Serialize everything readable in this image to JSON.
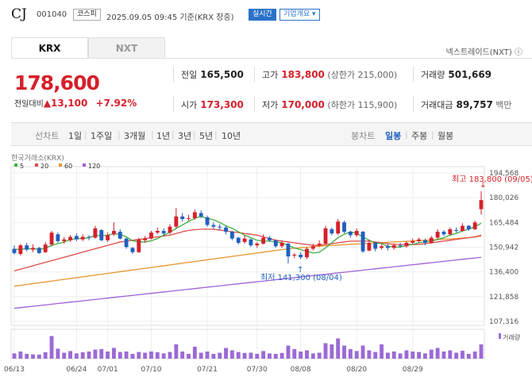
{
  "header": {
    "name": "CJ",
    "code": "001040",
    "market": "코스피",
    "timestamp": "2025.09.05 09:45  기준(KRX 장중)",
    "realtime": "실시간",
    "company_info": "기업개요 ▾"
  },
  "tabs": [
    "KRX",
    "NXT"
  ],
  "nxt_link": "넥스트레이드(NXT) ⓘ",
  "quote": {
    "price": "178,600",
    "change_label": "전일대비",
    "change_arrow": "▲",
    "change": "13,100",
    "change_pct": "+7.92%"
  },
  "stats": {
    "prev_close_label": "전일",
    "prev_close": "165,500",
    "high_label": "고가",
    "high": "183,800",
    "upper_limit": "(상한가 215,000)",
    "volume_label": "거래량",
    "volume": "501,669",
    "open_label": "시가",
    "open": "173,300",
    "low_label": "저가",
    "low": "170,000",
    "lower_limit": "(하한가 115,900)",
    "value_label": "거래대금",
    "value": "89,757",
    "value_unit": "백만"
  },
  "period_bar": {
    "line_label": "선차트",
    "line_periods": [
      "1일",
      "1주일",
      "3개월",
      "1년",
      "3년",
      "5년",
      "10년"
    ],
    "candle_label": "봉차트",
    "candle_periods": [
      "일봉",
      "주봉",
      "월봉"
    ],
    "active": "일봉"
  },
  "colors": {
    "up": "#d6202a",
    "down": "#1f5fbf",
    "ma5": "#3fae3f",
    "ma20": "#e04a4a",
    "ma60": "#e8952e",
    "ma120": "#a060d8",
    "volume": "#9b6ad6"
  },
  "chart_data": {
    "type": "candlestick",
    "source_label": "한국거래소(KRX)",
    "legend": [
      "5",
      "20",
      "60",
      "120"
    ],
    "y_ticks": [
      194568,
      180026,
      165484,
      150942,
      136400,
      121858,
      107316
    ],
    "x_ticks": [
      "06/13",
      "06/24",
      "07/01",
      "07/10",
      "07/21",
      "07/30",
      "08/08",
      "08/20",
      "08/29"
    ],
    "annotation_high": "최고 183,800 (09/05)",
    "annotation_low": "최저 141,300 (08/04)",
    "volume_label": "거래량",
    "candles": [
      {
        "o": 150000,
        "c": 147500,
        "h": 152000,
        "l": 146500,
        "v": 0.22
      },
      {
        "o": 147000,
        "c": 152000,
        "h": 152800,
        "l": 146000,
        "v": 0.3
      },
      {
        "o": 152000,
        "c": 149500,
        "h": 153500,
        "l": 148500,
        "v": 0.2
      },
      {
        "o": 149500,
        "c": 150500,
        "h": 152500,
        "l": 148000,
        "v": 0.18
      },
      {
        "o": 150500,
        "c": 147500,
        "h": 151000,
        "l": 147000,
        "v": 0.17
      },
      {
        "o": 148000,
        "c": 152500,
        "h": 154000,
        "l": 147500,
        "v": 0.27
      },
      {
        "o": 152500,
        "c": 159500,
        "h": 160500,
        "l": 151500,
        "v": 0.95
      },
      {
        "o": 158500,
        "c": 154500,
        "h": 159500,
        "l": 153500,
        "v": 0.42
      },
      {
        "o": 154500,
        "c": 155500,
        "h": 157000,
        "l": 153000,
        "v": 0.25
      },
      {
        "o": 155000,
        "c": 157000,
        "h": 158000,
        "l": 154000,
        "v": 0.32
      },
      {
        "o": 157500,
        "c": 155500,
        "h": 159000,
        "l": 154500,
        "v": 0.22
      },
      {
        "o": 155500,
        "c": 157000,
        "h": 158500,
        "l": 154500,
        "v": 0.27
      },
      {
        "o": 157000,
        "c": 156500,
        "h": 158000,
        "l": 155000,
        "v": 0.3
      },
      {
        "o": 156500,
        "c": 162000,
        "h": 163500,
        "l": 156000,
        "v": 0.38
      },
      {
        "o": 161000,
        "c": 155000,
        "h": 161500,
        "l": 154500,
        "v": 0.4
      },
      {
        "o": 155000,
        "c": 158000,
        "h": 159500,
        "l": 154000,
        "v": 0.3
      },
      {
        "o": 158500,
        "c": 160500,
        "h": 165500,
        "l": 157500,
        "v": 0.45
      },
      {
        "o": 160000,
        "c": 156000,
        "h": 161500,
        "l": 155500,
        "v": 0.28
      },
      {
        "o": 156000,
        "c": 151000,
        "h": 156500,
        "l": 150000,
        "v": 0.3
      },
      {
        "o": 150500,
        "c": 148000,
        "h": 151000,
        "l": 147000,
        "v": 0.2
      },
      {
        "o": 148000,
        "c": 155500,
        "h": 156500,
        "l": 147500,
        "v": 0.28
      },
      {
        "o": 155000,
        "c": 156000,
        "h": 157500,
        "l": 153500,
        "v": 0.25
      },
      {
        "o": 156000,
        "c": 159500,
        "h": 160500,
        "l": 155500,
        "v": 0.3
      },
      {
        "o": 159500,
        "c": 160500,
        "h": 162500,
        "l": 158500,
        "v": 0.27
      },
      {
        "o": 160500,
        "c": 159000,
        "h": 162000,
        "l": 158000,
        "v": 0.22
      },
      {
        "o": 159500,
        "c": 163000,
        "h": 164500,
        "l": 158500,
        "v": 0.28
      },
      {
        "o": 163000,
        "c": 169000,
        "h": 174000,
        "l": 162000,
        "v": 0.6
      },
      {
        "o": 169000,
        "c": 167500,
        "h": 171000,
        "l": 166000,
        "v": 0.3
      },
      {
        "o": 168000,
        "c": 168000,
        "h": 170000,
        "l": 166500,
        "v": 0.2
      },
      {
        "o": 168000,
        "c": 171500,
        "h": 173000,
        "l": 167000,
        "v": 0.5
      },
      {
        "o": 171000,
        "c": 169000,
        "h": 172500,
        "l": 168000,
        "v": 0.25
      },
      {
        "o": 168500,
        "c": 164000,
        "h": 169500,
        "l": 163000,
        "v": 0.3
      },
      {
        "o": 164000,
        "c": 163000,
        "h": 165500,
        "l": 161500,
        "v": 0.2
      },
      {
        "o": 163000,
        "c": 162500,
        "h": 164500,
        "l": 161000,
        "v": 0.25
      },
      {
        "o": 162500,
        "c": 160000,
        "h": 163500,
        "l": 158500,
        "v": 0.45
      },
      {
        "o": 160000,
        "c": 156000,
        "h": 160500,
        "l": 155000,
        "v": 0.35
      },
      {
        "o": 156500,
        "c": 153500,
        "h": 157000,
        "l": 152500,
        "v": 0.28
      },
      {
        "o": 154000,
        "c": 156000,
        "h": 158000,
        "l": 153000,
        "v": 0.24
      },
      {
        "o": 155500,
        "c": 152000,
        "h": 156000,
        "l": 151000,
        "v": 0.25
      },
      {
        "o": 152000,
        "c": 153000,
        "h": 154000,
        "l": 150500,
        "v": 0.2
      },
      {
        "o": 153000,
        "c": 156500,
        "h": 158500,
        "l": 152500,
        "v": 0.32
      },
      {
        "o": 156500,
        "c": 155000,
        "h": 157500,
        "l": 154000,
        "v": 0.22
      },
      {
        "o": 155000,
        "c": 151500,
        "h": 155500,
        "l": 150500,
        "v": 0.2
      },
      {
        "o": 151500,
        "c": 153500,
        "h": 155000,
        "l": 150500,
        "v": 0.24
      },
      {
        "o": 153000,
        "c": 145500,
        "h": 153500,
        "l": 141300,
        "v": 0.55
      },
      {
        "o": 146000,
        "c": 146500,
        "h": 147500,
        "l": 144500,
        "v": 0.4
      },
      {
        "o": 146500,
        "c": 145000,
        "h": 148000,
        "l": 144000,
        "v": 0.3
      },
      {
        "o": 145000,
        "c": 150000,
        "h": 151000,
        "l": 144000,
        "v": 0.35
      },
      {
        "o": 150000,
        "c": 151500,
        "h": 153000,
        "l": 149000,
        "v": 0.22
      },
      {
        "o": 152000,
        "c": 153000,
        "h": 155000,
        "l": 151000,
        "v": 0.25
      },
      {
        "o": 153000,
        "c": 162000,
        "h": 163500,
        "l": 152500,
        "v": 0.65
      },
      {
        "o": 161500,
        "c": 159000,
        "h": 162500,
        "l": 158000,
        "v": 0.6
      },
      {
        "o": 159000,
        "c": 166000,
        "h": 167500,
        "l": 158000,
        "v": 0.85
      },
      {
        "o": 165500,
        "c": 160000,
        "h": 166500,
        "l": 159000,
        "v": 0.55
      },
      {
        "o": 160000,
        "c": 158000,
        "h": 160500,
        "l": 156500,
        "v": 0.4
      },
      {
        "o": 158000,
        "c": 160500,
        "h": 162000,
        "l": 157000,
        "v": 0.32
      },
      {
        "o": 160000,
        "c": 148500,
        "h": 160500,
        "l": 147500,
        "v": 0.55
      },
      {
        "o": 149000,
        "c": 153500,
        "h": 155500,
        "l": 148500,
        "v": 0.35
      },
      {
        "o": 153500,
        "c": 150000,
        "h": 154000,
        "l": 148500,
        "v": 0.28
      },
      {
        "o": 150500,
        "c": 151500,
        "h": 152500,
        "l": 149500,
        "v": 0.6
      },
      {
        "o": 151500,
        "c": 150500,
        "h": 153000,
        "l": 149000,
        "v": 0.25
      },
      {
        "o": 150500,
        "c": 152000,
        "h": 153000,
        "l": 149500,
        "v": 0.3
      },
      {
        "o": 152000,
        "c": 151500,
        "h": 153500,
        "l": 150500,
        "v": 0.22
      },
      {
        "o": 151500,
        "c": 153500,
        "h": 154500,
        "l": 150500,
        "v": 0.35
      },
      {
        "o": 153500,
        "c": 154500,
        "h": 156000,
        "l": 152500,
        "v": 0.3
      },
      {
        "o": 154500,
        "c": 155500,
        "h": 156500,
        "l": 153500,
        "v": 0.28
      },
      {
        "o": 155000,
        "c": 153500,
        "h": 156000,
        "l": 152000,
        "v": 0.22
      },
      {
        "o": 153500,
        "c": 156500,
        "h": 157500,
        "l": 153000,
        "v": 0.38
      },
      {
        "o": 156500,
        "c": 160000,
        "h": 161500,
        "l": 155500,
        "v": 0.45
      },
      {
        "o": 160000,
        "c": 158500,
        "h": 161000,
        "l": 157500,
        "v": 0.3
      },
      {
        "o": 158500,
        "c": 161500,
        "h": 162500,
        "l": 158000,
        "v": 0.35
      },
      {
        "o": 161000,
        "c": 160500,
        "h": 162500,
        "l": 159500,
        "v": 0.25
      },
      {
        "o": 160500,
        "c": 163500,
        "h": 165000,
        "l": 160000,
        "v": 0.33
      },
      {
        "o": 163500,
        "c": 161500,
        "h": 164000,
        "l": 160500,
        "v": 0.2
      },
      {
        "o": 161500,
        "c": 165500,
        "h": 166500,
        "l": 161000,
        "v": 0.3
      },
      {
        "o": 173300,
        "c": 178600,
        "h": 183800,
        "l": 170000,
        "v": 0.6
      }
    ],
    "ma5": [
      149500,
      149800,
      150000,
      150000,
      149700,
      150300,
      152000,
      153000,
      154000,
      155400,
      156000,
      156000,
      156500,
      158000,
      157600,
      158000,
      158800,
      158500,
      157000,
      154700,
      154000,
      154000,
      154700,
      156000,
      158000,
      159700,
      162000,
      164000,
      166000,
      168000,
      169000,
      168000,
      167000,
      165500,
      163500,
      162000,
      160000,
      158000,
      156500,
      155000,
      154500,
      154500,
      154000,
      153500,
      152000,
      150500,
      149500,
      148500,
      147500,
      148000,
      150500,
      153500,
      156500,
      158500,
      160000,
      159000,
      157000,
      155000,
      153500,
      153000,
      151500,
      151000,
      151000,
      152000,
      152500,
      153500,
      154000,
      154500,
      155500,
      156500,
      158000,
      159000,
      160500,
      161500,
      163000,
      165000
    ],
    "ma20": [
      137000,
      138000,
      139000,
      140000,
      141000,
      142000,
      143000,
      144000,
      145000,
      146000,
      147000,
      148000,
      149000,
      150000,
      151000,
      152000,
      153000,
      154000,
      154500,
      155000,
      155500,
      156000,
      156500,
      157000,
      157500,
      158000,
      159000,
      160000,
      160800,
      161200,
      161500,
      161500,
      161500,
      161000,
      160500,
      160000,
      159500,
      159000,
      158500,
      158000,
      157000,
      156000,
      155000,
      154500,
      154000,
      153500,
      153000,
      152500,
      152000,
      152000,
      152500,
      153000,
      153500,
      154000,
      154500,
      154500,
      154500,
      154500,
      154000,
      153500,
      153000,
      152500,
      152500,
      152500,
      152500,
      152500,
      153000,
      153500,
      154000,
      154500,
      155000,
      155500,
      156000,
      156500,
      157000,
      158000
    ],
    "ma60": [
      128000,
      128500,
      129000,
      129500,
      130000,
      130500,
      131000,
      131500,
      132000,
      132500,
      133000,
      133500,
      134000,
      134500,
      135000,
      135500,
      136000,
      136500,
      137000,
      137500,
      138000,
      138500,
      139000,
      139500,
      140000,
      140500,
      141000,
      141500,
      142000,
      142500,
      143000,
      143500,
      144000,
      144500,
      145000,
      145500,
      146000,
      146500,
      147000,
      147500,
      148000,
      148500,
      149000,
      149500,
      150000,
      150300,
      150600,
      150900,
      151200,
      151500,
      151800,
      152000,
      152200,
      152400,
      152600,
      152800,
      153000,
      153200,
      153400,
      153600,
      153800,
      154000,
      154200,
      154400,
      154600,
      154800,
      155000,
      155200,
      155400,
      155600,
      155800,
      156000,
      156300,
      156600,
      156900,
      157500
    ],
    "ma120": [
      115000,
      115400,
      115800,
      116200,
      116600,
      117000,
      117400,
      117800,
      118200,
      118600,
      119000,
      119400,
      119800,
      120200,
      120600,
      121000,
      121400,
      121800,
      122200,
      122600,
      123000,
      123400,
      123800,
      124200,
      124600,
      125000,
      125400,
      125800,
      126200,
      126600,
      127000,
      127400,
      127800,
      128200,
      128600,
      129000,
      129400,
      129800,
      130200,
      130600,
      131000,
      131400,
      131800,
      132200,
      132600,
      133000,
      133400,
      133800,
      134200,
      134600,
      135000,
      135400,
      135800,
      136200,
      136600,
      137000,
      137400,
      137800,
      138200,
      138600,
      139000,
      139400,
      139800,
      140200,
      140600,
      141000,
      141400,
      141800,
      142200,
      142600,
      143000,
      143400,
      143800,
      144200,
      144600,
      145000
    ]
  }
}
